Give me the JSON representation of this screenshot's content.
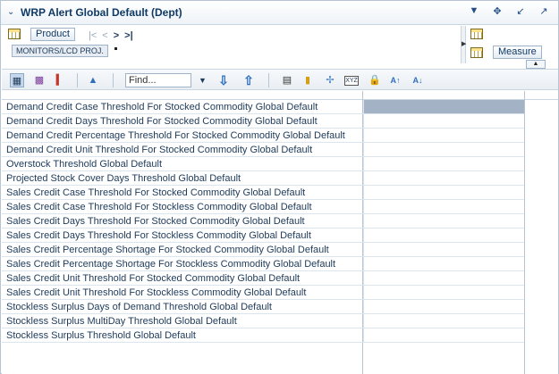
{
  "header": {
    "title": "WRP Alert Global Default (Dept)",
    "icons": [
      "menu-dropdown-icon",
      "move-icon",
      "minimize-icon",
      "maximize-icon"
    ]
  },
  "edge": {
    "row_dimension": "Product",
    "selected_member": "MONITORS/LCD PROJ.",
    "column_dimension": "Measure"
  },
  "toolbar": {
    "find_placeholder": "Find..."
  },
  "table": {
    "rows": [
      "Demand Credit Case Threshold For Stocked Commodity Global Default",
      "Demand Credit Days Threshold For Stocked Commodity Global Default",
      "Demand Credit Percentage Threshold For Stocked Commodity Global Default",
      "Demand Credit Unit Threshold For Stocked Commodity Global Default",
      "Overstock Threshold Global Default",
      "Projected Stock Cover Days Threshold Global Default",
      "Sales Credit Case Threshold For Stocked Commodity Global Default",
      "Sales Credit Case Threshold For Stockless Commodity Global Default",
      "Sales Credit Days Threshold For Stocked Commodity Global Default",
      "Sales Credit Days Threshold For Stockless Commodity Global Default",
      "Sales Credit Percentage Shortage For Stocked Commodity Global Default",
      "Sales Credit Percentage Shortage For Stockless Commodity Global Default",
      "Sales Credit Unit Threshold For Stocked Commodity Global Default",
      "Sales Credit Unit Threshold For Stockless Commodity Global Default",
      "Stockless Surplus Days of Demand Threshold Global Default",
      "Stockless Surplus MultiDay Threshold Global Default",
      "Stockless Surplus Threshold Global Default"
    ],
    "selected_cell_color": "#a3b3c5"
  }
}
